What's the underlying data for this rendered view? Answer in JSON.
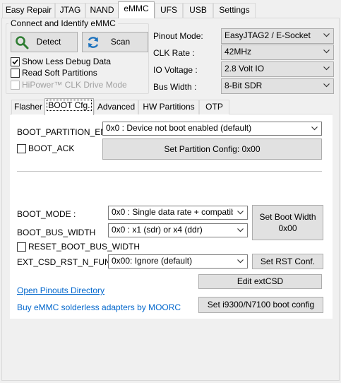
{
  "main_tabs": [
    "Easy Repair",
    "JTAG",
    "NAND",
    "eMMC",
    "UFS",
    "USB",
    "Settings"
  ],
  "connect": {
    "title": "Connect and Identify eMMC",
    "detect_label": "Detect",
    "scan_label": "Scan",
    "show_less_debug": "Show Less Debug Data",
    "read_soft_partitions": "Read Soft Partitions",
    "hipower": "HiPower™ CLK Drive Mode",
    "show_less_debug_checked": true,
    "read_soft_partitions_checked": false,
    "hipower_checked": false
  },
  "settings": {
    "pinout_label": "Pinout Mode:",
    "pinout_value": "EasyJTAG2 / E-Socket",
    "clk_label": "CLK Rate :",
    "clk_value": "42MHz",
    "io_label": "IO Voltage :",
    "io_value": "2.8 Volt IO",
    "bus_label": "Bus Width :",
    "bus_value": "8-Bit SDR"
  },
  "sub_tabs": [
    "Flasher",
    "BOOT Cfg.",
    "Advanced",
    "HW Partitions",
    "OTP"
  ],
  "boot": {
    "partition_en_label": "BOOT_PARTITION_EN:",
    "partition_en_value": "0x0 : Device not boot enabled (default)",
    "boot_ack": "BOOT_ACK",
    "boot_ack_checked": false,
    "set_partition_config": "Set Partition Config: 0x00",
    "boot_mode_label": "BOOT_MODE :",
    "boot_mode_value": "0x0 : Single data rate + compatibl",
    "boot_bus_width_label": "BOOT_BUS_WIDTH",
    "boot_bus_width_value": "0x0 : x1 (sdr) or x4 (ddr)",
    "set_boot_width_line1": "Set Boot Width",
    "set_boot_width_line2": "0x00",
    "reset_boot_bus_width": "RESET_BOOT_BUS_WIDTH",
    "reset_boot_bus_width_checked": false,
    "ext_csd_rst_label": "EXT_CSD_RST_N_FUNC.",
    "ext_csd_rst_value": "0x00: Ignore (default)",
    "set_rst_conf": "Set RST Conf.",
    "edit_extcsd": "Edit extCSD",
    "open_pinouts": "Open Pinouts Directory",
    "buy_adapters": "Buy eMMC solderless adapters by MOORC",
    "set_i9300": "Set i9300/N7100 boot config"
  },
  "colors": {
    "link": "#0066cc",
    "detect_icon": "#2e7d32",
    "scan_icon": "#1e73be"
  }
}
